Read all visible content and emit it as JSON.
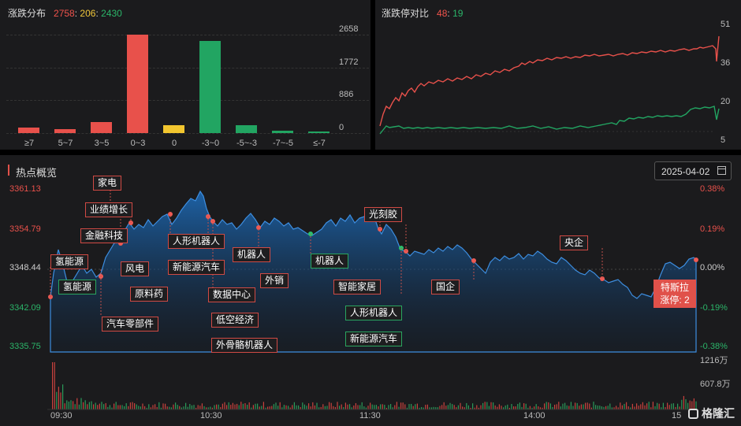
{
  "dist": {
    "title": "涨跌分布",
    "up": "2758",
    "flat": "206",
    "down": "2430",
    "sep": ":",
    "y_ticks": [
      "2658",
      "1772",
      "886",
      "0"
    ],
    "colors": {
      "up": "#e8514b",
      "flat": "#f2c62f",
      "down": "#22a562"
    }
  },
  "chart_data": [
    {
      "type": "bar",
      "title": "涨跌分布",
      "categories": [
        "≥7",
        "5~7",
        "3~5",
        "0~3",
        "0",
        "-3~0",
        "-5~-3",
        "-7~-5",
        "≤-7"
      ],
      "values": [
        150,
        100,
        300,
        2658,
        206,
        2480,
        210,
        60,
        50
      ],
      "colors": [
        "up",
        "up",
        "up",
        "up",
        "flat",
        "down",
        "down",
        "down",
        "down"
      ],
      "ylim": [
        0,
        2658
      ]
    },
    {
      "type": "line",
      "title": "涨跌停对比",
      "series": [
        {
          "name": "涨停",
          "value_now": 48,
          "color": "#e8514b"
        },
        {
          "name": "跌停",
          "value_now": 19,
          "color": "#22a562"
        }
      ],
      "y_ticks": [
        51,
        36,
        20,
        5
      ],
      "ylim": [
        5,
        51
      ]
    },
    {
      "type": "area",
      "title": "热点概览",
      "x_ticks": [
        "09:30",
        "10:30",
        "11:30",
        "14:00",
        "15"
      ],
      "y_ticks": [
        3361.13,
        3354.79,
        3348.44,
        3342.09,
        3335.75
      ],
      "pct_ticks": [
        "0.38%",
        "0.19%",
        "0.00%",
        "-0.19%",
        "-0.38%"
      ],
      "ylim": [
        3335.75,
        3361.13
      ],
      "volume_ticks": [
        "1216万",
        "607.8万"
      ]
    }
  ],
  "cmp": {
    "title": "涨跌停对比",
    "up": "48",
    "down": "19",
    "sep": ":",
    "y_ticks": [
      "51",
      "36",
      "20",
      "5"
    ]
  },
  "hot": {
    "title": "热点概览",
    "date": "2025-04-02",
    "y_left": [
      "3361.13",
      "3354.79",
      "3348.44",
      "3342.09",
      "3335.75"
    ],
    "y_right": [
      "0.38%",
      "0.19%",
      "0.00%",
      "-0.19%",
      "-0.38%"
    ],
    "vol": [
      "1216万",
      "607.8万"
    ],
    "x_ticks": [
      "09:30",
      "10:30",
      "11:30",
      "14:00",
      "15"
    ],
    "tags": [
      "家电",
      "业绩增长",
      "金融科技",
      "氢能源",
      "氢能源",
      "风电",
      "原料药",
      "汽车零部件",
      "人形机器人",
      "新能源汽车",
      "数据中心",
      "低空经济",
      "外骨骼机器人",
      "机器人",
      "外销",
      "机器人",
      "光刻胶",
      "智能家居",
      "人形机器人",
      "新能源汽车",
      "国企",
      "央企"
    ],
    "badge_line1": "特斯拉",
    "badge_line2": "涨停: 2",
    "logo": "格隆汇"
  }
}
